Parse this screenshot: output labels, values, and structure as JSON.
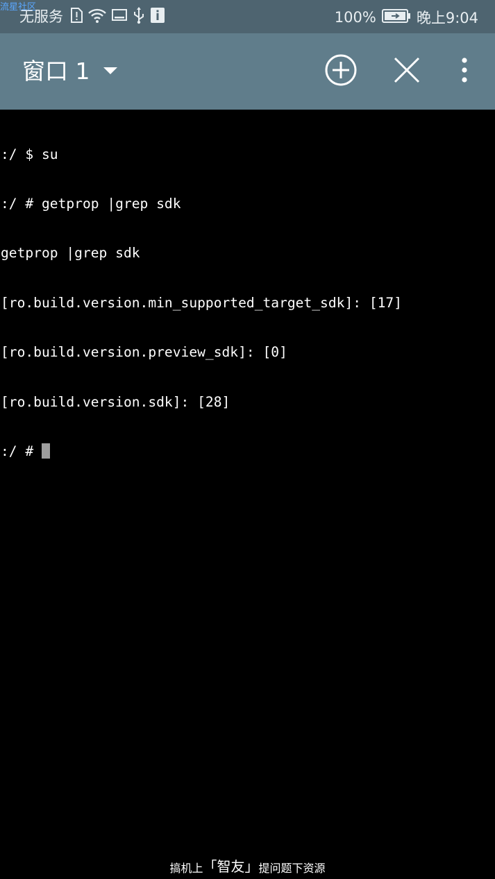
{
  "status_bar": {
    "watermark": "流星社区",
    "carrier": "无服务",
    "battery_percent": "100%",
    "time": "晚上9:04",
    "icons": [
      "sim-alert-icon",
      "wifi-icon",
      "screen-cast-icon",
      "usb-icon",
      "info-icon",
      "battery-charging-icon"
    ]
  },
  "app_bar": {
    "window_title": "窗口 1",
    "icons": [
      "dropdown-arrow-icon",
      "add-circle-icon",
      "close-icon",
      "more-vert-icon"
    ]
  },
  "terminal": {
    "lines": [
      ":/ $ su",
      ":/ # getprop |grep sdk",
      "getprop |grep sdk",
      "[ro.build.version.min_supported_target_sdk]: [17]",
      "[ro.build.version.preview_sdk]: [0]",
      "[ro.build.version.sdk]: [28]"
    ],
    "prompt": ":/ # "
  },
  "footer_watermark": {
    "prefix": "搞机上",
    "brand": "「智友」",
    "suffix": "提问题下资源"
  },
  "colors": {
    "status_bar_bg": "#4e6470",
    "app_bar_bg": "#607d8b",
    "terminal_bg": "#000000",
    "terminal_text": "#ffffff",
    "cursor": "#9e9e9e"
  }
}
